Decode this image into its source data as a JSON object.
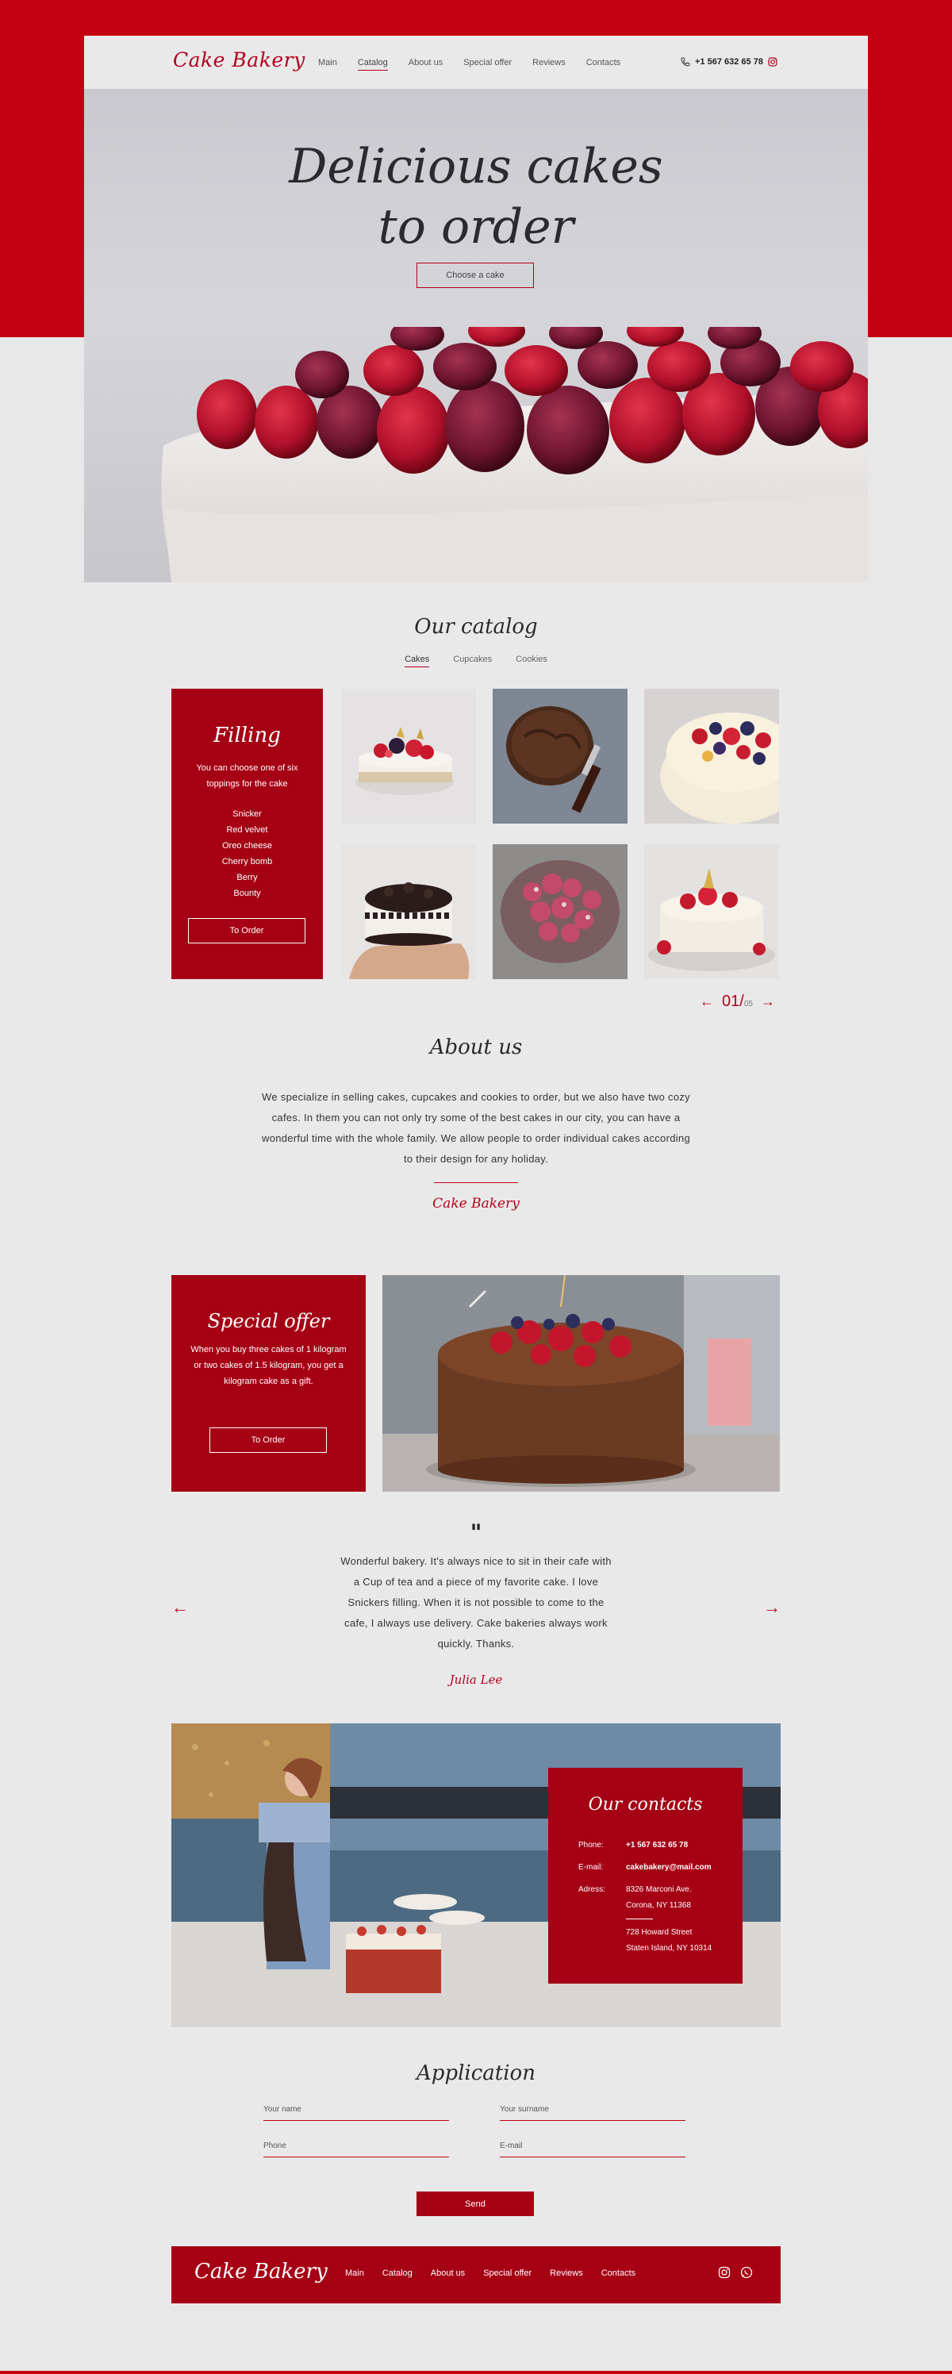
{
  "header": {
    "logo": "Cake Bakery",
    "nav": [
      "Main",
      "Catalog",
      "About us",
      "Special offer",
      "Reviews",
      "Contacts"
    ],
    "active_nav": "Catalog",
    "phone": "+1 567 632 65 78"
  },
  "hero": {
    "title_line1": "Delicious cakes",
    "title_line2": "to order",
    "button": "Choose a cake"
  },
  "catalog": {
    "title": "Our catalog",
    "tabs": [
      "Cakes",
      "Cupcakes",
      "Cookies"
    ],
    "filling": {
      "title": "Filling",
      "text": "You can choose one of six toppings for the cake",
      "items": [
        "Snicker",
        "Red velvet",
        "Oreo cheese",
        "Cherry bomb",
        "Berry",
        "Bounty"
      ],
      "button": "To Order"
    },
    "pager": {
      "current": "01",
      "total": "05"
    }
  },
  "about": {
    "title": "About us",
    "text": "We specialize in selling cakes, cupcakes and cookies to order, but we also have two cozy cafes. In them you can not only try some of the best cakes in our city, you can have a wonderful time with the whole family. We allow people to order individual cakes according to their design for any holiday.",
    "signature": "Cake Bakery"
  },
  "special": {
    "title": "Special offer",
    "text": "When you buy three cakes of 1 kilogram or two cakes of 1.5 kilogram, you get a kilogram cake as a gift.",
    "button": "To Order"
  },
  "review": {
    "quote": "\"",
    "text": "Wonderful bakery. It's always nice to sit in their cafe with a Cup of tea and a piece of my favorite cake. I love Snickers filling. When it is not possible to come to the cafe, I always use delivery. Cake bakeries always work quickly. Thanks.",
    "author": "Julia Lee"
  },
  "contacts": {
    "title": "Our contacts",
    "phone_label": "Phone:",
    "phone": "+1 567 632 65 78",
    "email_label": "E-mail:",
    "email": "cakebakery@mail.com",
    "address_label": "Adress:",
    "address1_line1": "8326 Marconi Ave.",
    "address1_line2": "Corona, NY 11368",
    "address2_line1": "728 Howard Street",
    "address2_line2": "Staten Island, NY 10314"
  },
  "application": {
    "title": "Application",
    "name_placeholder": "Your name",
    "surname_placeholder": "Your surname",
    "phone_placeholder": "Phone",
    "email_placeholder": "E-mail",
    "send": "Send"
  },
  "footer": {
    "logo": "Cake Bakery",
    "nav": [
      "Main",
      "Catalog",
      "About us",
      "Special offer",
      "Reviews",
      "Contacts"
    ]
  },
  "colors": {
    "brand_red": "#c3000f",
    "card_red": "#a50014",
    "page_bg": "#e9e9ea"
  }
}
